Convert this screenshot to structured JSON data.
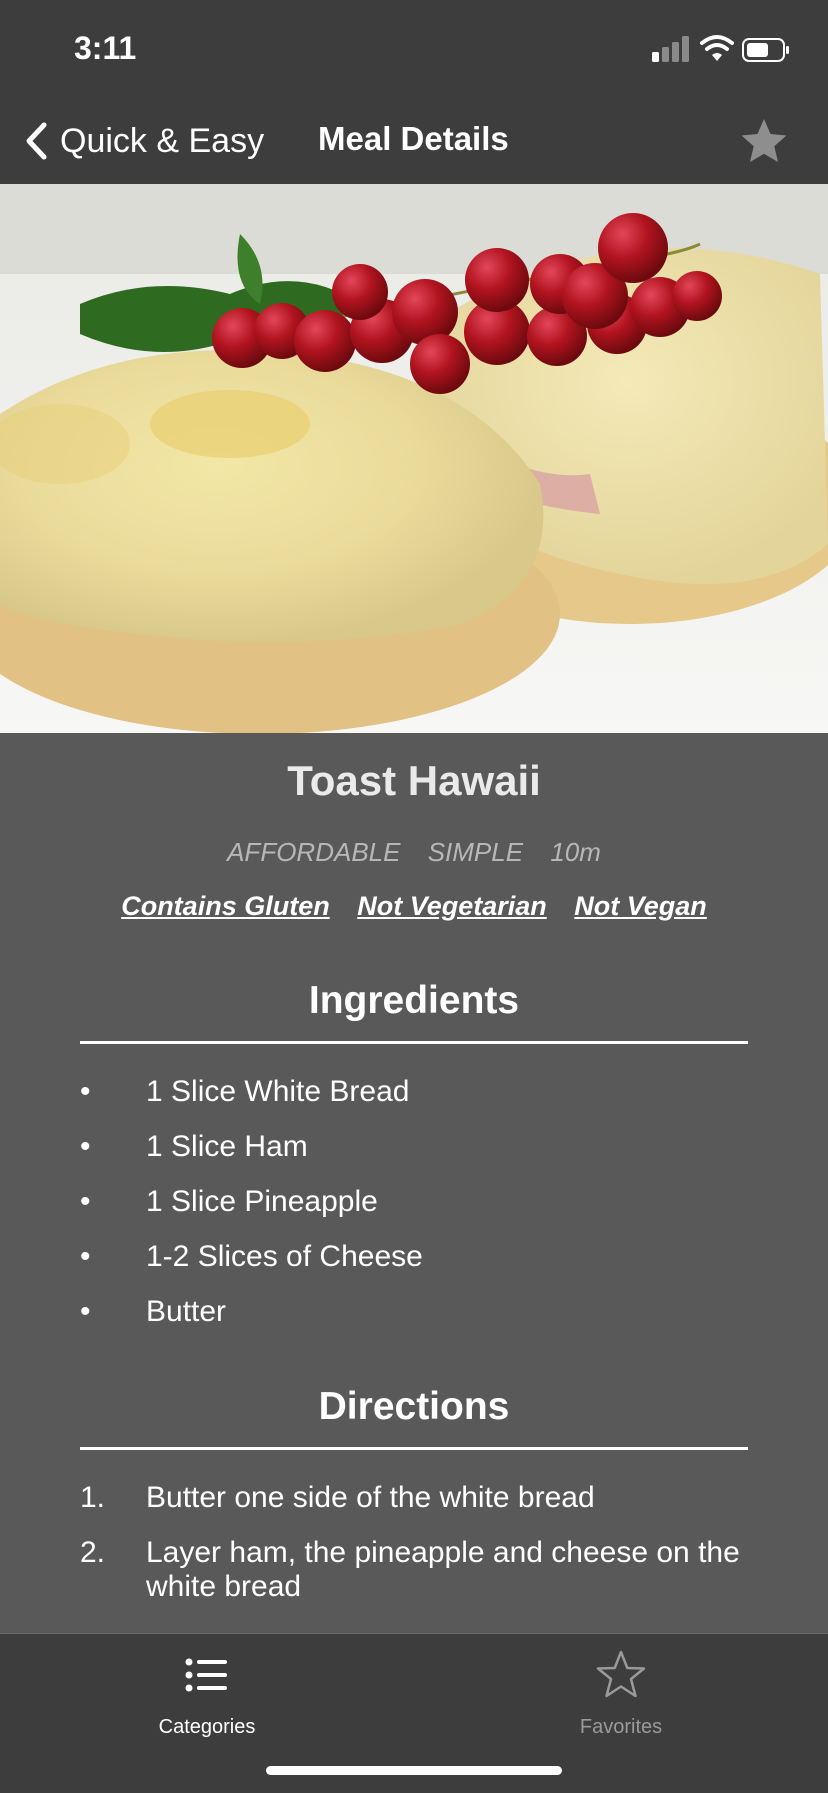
{
  "status": {
    "time": "3:11"
  },
  "nav": {
    "back_label": "Quick & Easy",
    "title": "Meal Details"
  },
  "meal": {
    "title": "Toast Hawaii",
    "affordability": "AFFORDABLE",
    "complexity": "SIMPLE",
    "duration": "10m",
    "tags": [
      "Contains Gluten",
      "Not Vegetarian",
      "Not Vegan"
    ]
  },
  "ingredients": {
    "title": "Ingredients",
    "bullet": "•",
    "items": [
      "1 Slice White Bread",
      "1 Slice Ham",
      "1 Slice Pineapple",
      "1-2 Slices of Cheese",
      "Butter"
    ]
  },
  "directions": {
    "title": "Directions",
    "items": [
      {
        "num": "1.",
        "text": "Butter one side of the white bread"
      },
      {
        "num": "2.",
        "text": "Layer ham, the pineapple and cheese on the white bread"
      }
    ]
  },
  "tabs": {
    "categories": "Categories",
    "favorites": "Favorites"
  },
  "colors": {
    "bar": "#3d3d3d",
    "content": "#595959",
    "active_tab": "#ffffff",
    "inactive_tab": "#9a9a9a"
  }
}
